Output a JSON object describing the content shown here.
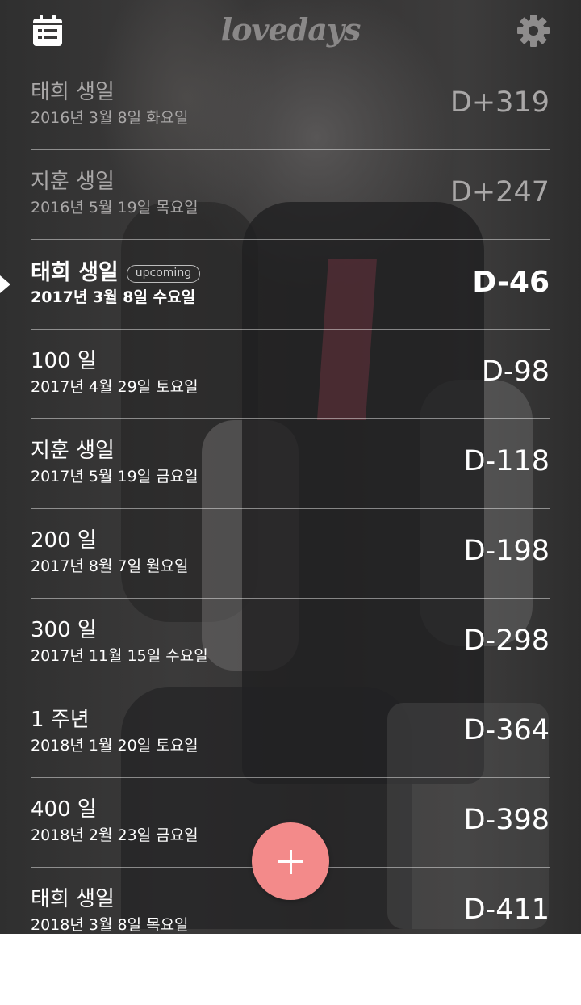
{
  "app": {
    "logo_text": "lovedays"
  },
  "colors": {
    "fab": "#f38a8a",
    "text": "#ffffff",
    "past_text": "#a9a7a7"
  },
  "icons": {
    "left": "calendar-list-icon",
    "right": "gear-icon",
    "fab": "plus-icon"
  },
  "events": [
    {
      "title": "태희 생일",
      "date": "2016년 3월 8일 화요일",
      "dday": "D+319",
      "state": "past"
    },
    {
      "title": "지훈 생일",
      "date": "2016년 5월 19일 목요일",
      "dday": "D+247",
      "state": "past"
    },
    {
      "title": "태희 생일",
      "date": "2017년 3월 8일 수요일",
      "dday": "D-46",
      "state": "upcoming",
      "badge": "upcoming"
    },
    {
      "title": "100 일",
      "date": "2017년 4월 29일 토요일",
      "dday": "D-98",
      "state": "future"
    },
    {
      "title": "지훈 생일",
      "date": "2017년 5월 19일 금요일",
      "dday": "D-118",
      "state": "future"
    },
    {
      "title": "200 일",
      "date": "2017년 8월 7일 월요일",
      "dday": "D-198",
      "state": "future"
    },
    {
      "title": "300 일",
      "date": "2017년 11월 15일 수요일",
      "dday": "D-298",
      "state": "future"
    },
    {
      "title": "1 주년",
      "date": "2018년 1월 20일 토요일",
      "dday": "D-364",
      "state": "future"
    },
    {
      "title": "400 일",
      "date": "2018년 2월 23일 금요일",
      "dday": "D-398",
      "state": "future"
    },
    {
      "title": "태희 생일",
      "date": "2018년 3월 8일 목요일",
      "dday": "D-411",
      "state": "future"
    }
  ]
}
